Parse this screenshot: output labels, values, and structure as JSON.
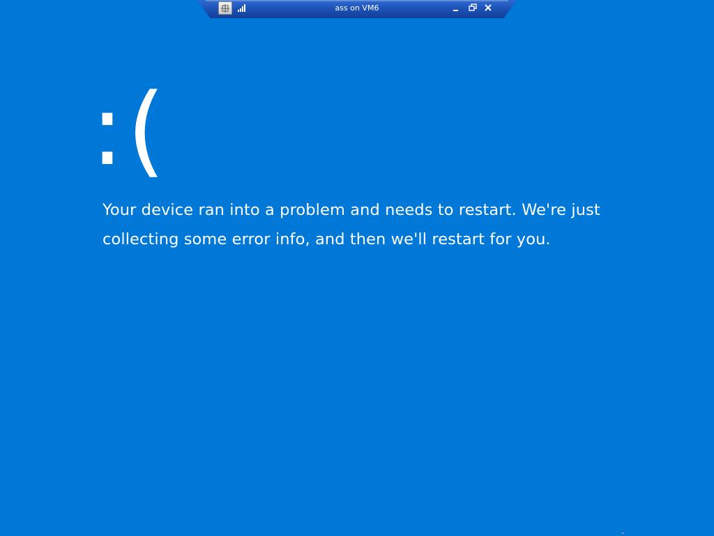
{
  "connection_bar": {
    "title": "ass on VM6",
    "icons": {
      "pin": "pin-icon",
      "signal": "signal-strength-icon",
      "minimize": "minimize-icon",
      "restore": "restore-icon",
      "close": "close-icon"
    },
    "background_color": "#1b4fb3"
  },
  "bsod": {
    "background_color": "#0078d7",
    "sad_face": ":(",
    "message_lines": [
      "Your device ran into a problem and needs to restart. We're just",
      "collecting some error info, and then we'll restart for you."
    ]
  }
}
